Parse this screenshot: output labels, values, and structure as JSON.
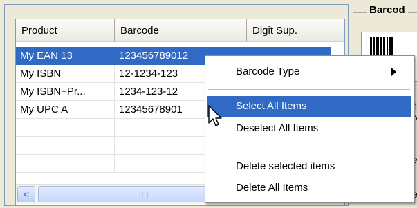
{
  "grid": {
    "columns": [
      "Product",
      "Barcode",
      "Digit Sup."
    ],
    "rows": [
      {
        "product": "My EAN 13",
        "barcode": "123456789012",
        "digit": "",
        "selected": true
      },
      {
        "product": "My ISBN",
        "barcode": "12-1234-123",
        "digit": "",
        "selected": false
      },
      {
        "product": "My ISBN+Pr...",
        "barcode": "1234-123-12",
        "digit": "",
        "selected": false
      },
      {
        "product": "My UPC A",
        "barcode": "12345678901",
        "digit": "",
        "selected": false
      }
    ],
    "scroll_left_glyph": "<",
    "scroll_grip_glyph": "||||"
  },
  "right_panel": {
    "title": "Barcod",
    "fragment_1": "4",
    "fragment_2": "AI",
    "fragment_3": "e",
    "fragment_4": "e"
  },
  "context_menu": {
    "items": [
      {
        "label": "Barcode Type",
        "has_submenu": true,
        "highlighted": false
      },
      {
        "label": "Select All Items",
        "has_submenu": false,
        "highlighted": true
      },
      {
        "label": "Deselect All Items",
        "has_submenu": false,
        "highlighted": false
      },
      {
        "label": "Delete selected items",
        "has_submenu": false,
        "highlighted": false
      },
      {
        "label": "Delete All Items",
        "has_submenu": false,
        "highlighted": false
      }
    ]
  },
  "colors": {
    "selection": "#316ac5",
    "window_bg": "#ece9d8",
    "border": "#7f9db9"
  },
  "icons": {
    "cursor": "arrow-cursor-icon",
    "submenu": "chevron-right-icon",
    "scroll_left": "scroll-left-arrow-icon"
  }
}
